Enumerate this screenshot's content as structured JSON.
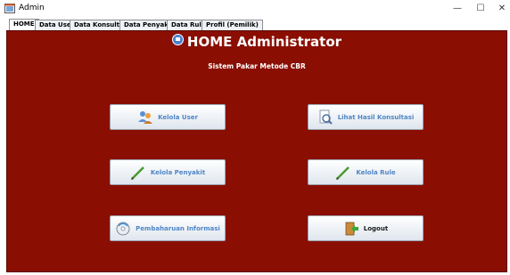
{
  "window": {
    "title": "Admin",
    "min_symbol": "—",
    "max_symbol": "☐",
    "close_symbol": "✕"
  },
  "tabs": [
    {
      "label": "HOME",
      "active": true
    },
    {
      "label": "Data User",
      "active": false
    },
    {
      "label": "Data Konsultasi",
      "active": false
    },
    {
      "label": "Data Penyakit",
      "active": false
    },
    {
      "label": "Data Rule",
      "active": false
    },
    {
      "label": "Profil (Pemilik)",
      "active": false
    }
  ],
  "main": {
    "title": "HOME Administrator",
    "subtitle": "Sistem Pakar Metode CBR",
    "background_color": "#8a0e02",
    "buttons": {
      "kelola_user": {
        "label": "Kelola User",
        "icon": "users-icon"
      },
      "lihat_hasil": {
        "label": "Lihat Hasil Konsultasi",
        "icon": "document-search-icon"
      },
      "kelola_penyakit": {
        "label": "Kelola Penyakit",
        "icon": "pencil-icon"
      },
      "kelola_rule": {
        "label": "Kelola Rule",
        "icon": "pencil-icon"
      },
      "pembaharuan": {
        "label": "Pembaharuan Informasi",
        "icon": "refresh-cd-icon"
      },
      "logout": {
        "label": "Logout",
        "icon": "logout-door-icon"
      }
    }
  },
  "colors": {
    "button_text": "#4f86c6",
    "panel_bg": "#8a0e02"
  }
}
